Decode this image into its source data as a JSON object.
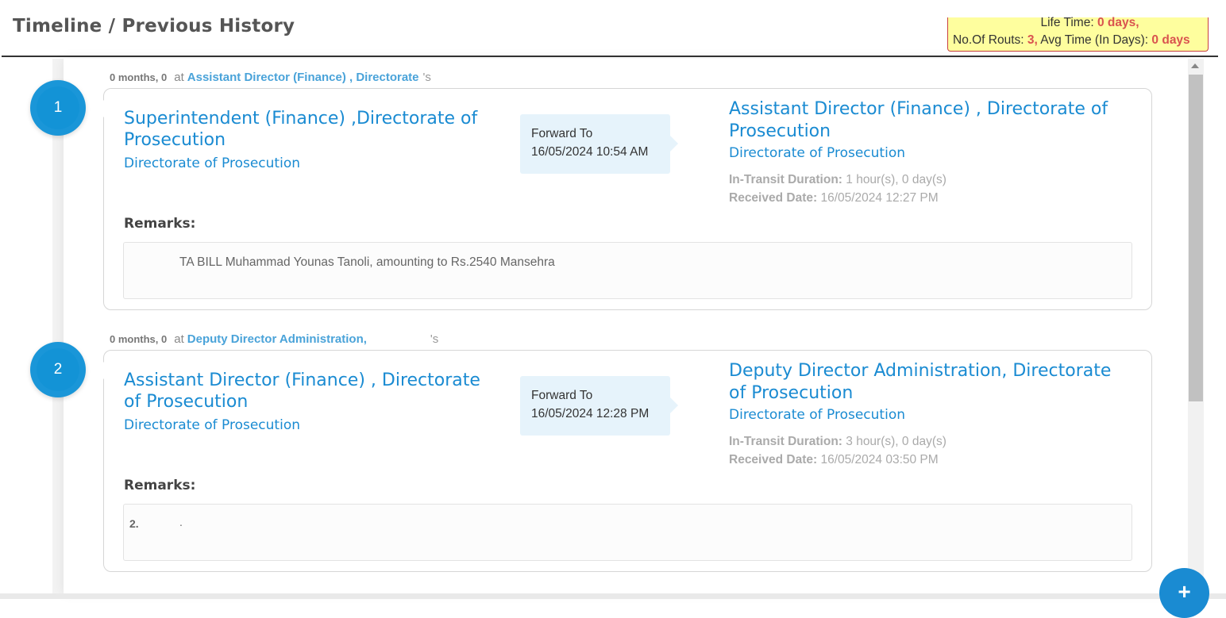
{
  "header": {
    "title": "Timeline / Previous History"
  },
  "summary": {
    "life_time_label": "Life Time:",
    "life_time_value": "0 days,",
    "routes_label": "No.Of Routs:",
    "routes_value": "3,",
    "avg_label": "Avg Time (In Days):",
    "avg_value": "0 days"
  },
  "entries": [
    {
      "number": "1",
      "duration": "0 months, 0",
      "at": "at",
      "at_office": "Assistant Director (Finance) , Directorate",
      "possessive": "'s",
      "from_title": "Superintendent (Finance) ,Directorate of Prosecution",
      "from_office": "Directorate of Prosecution",
      "forward_label": "Forward To",
      "forward_date": "16/05/2024 10:54 AM",
      "to_title": "Assistant Director (Finance) , Directorate of Prosecution",
      "to_office": "Directorate of Prosecution",
      "transit_label": "In-Transit Duration:",
      "transit_value": "1 hour(s), 0 day(s)",
      "received_label": "Received Date:",
      "received_value": "16/05/2024 12:27 PM",
      "remarks_label": "Remarks:",
      "remarks_number": "",
      "remarks_text": "TA BILL Muhammad Younas Tanoli, amounting to Rs.2540 Mansehra"
    },
    {
      "number": "2",
      "duration": "0 months, 0",
      "at": "at",
      "at_office": "Deputy Director Administration,",
      "possessive": "'s",
      "from_title": "Assistant Director (Finance) , Directorate of Prosecution",
      "from_office": "Directorate of Prosecution",
      "forward_label": "Forward To",
      "forward_date": "16/05/2024 12:28 PM",
      "to_title": "Deputy Director Administration, Directorate of Prosecution",
      "to_office": "Directorate of Prosecution",
      "transit_label": "In-Transit Duration:",
      "transit_value": "3 hour(s), 0 day(s)",
      "received_label": "Received Date:",
      "received_value": "16/05/2024 03:50 PM",
      "remarks_label": "Remarks:",
      "remarks_number": "2.",
      "remarks_text": "."
    }
  ],
  "fab": {
    "label": "+",
    "icon": "plus-icon"
  }
}
